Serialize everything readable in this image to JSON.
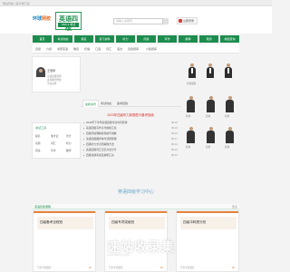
{
  "topbar": {
    "left_text": "网站导航 | 客户端下载",
    "right_text": ""
  },
  "header": {
    "logo_main": "环球",
    "logo_accent": "网校",
    "brand_title": "英语四级",
    "brand_subtitle": "CET-4 考试",
    "search_placeholder": "请输入关键词",
    "login_label": "立即登录"
  },
  "nav": [
    {
      "label": "首页"
    },
    {
      "label": "考试动态"
    },
    {
      "label": "报名"
    },
    {
      "label": "复习资料"
    },
    {
      "label": "听力"
    },
    {
      "label": "阅读"
    },
    {
      "label": "写作"
    },
    {
      "label": "翻译"
    },
    {
      "label": "真题"
    },
    {
      "label": "成绩查询"
    }
  ],
  "subnav": [
    "四级",
    "六级",
    "考研英语",
    "雅思",
    "托福",
    "口语",
    "词汇",
    "语法",
    "四级题库",
    "六级题库"
  ],
  "profile": {
    "name": "王老师",
    "lines": [
      "英语四级讲师",
      "多年教学经验",
      "学员好评"
    ]
  },
  "teacher_strip": {
    "label": "名师团队"
  },
  "news": {
    "tabs": [
      "最新资讯",
      "考试动态",
      "备考经验"
    ],
    "headline": "2023年四级听力新题型与备考指南",
    "items": [
      {
        "text": "2023年下半年英语四级考试时间安排",
        "date": "08-20"
      },
      {
        "text": "英语四级写作高分模板汇总",
        "date": "08-19"
      },
      {
        "text": "四级阅读理解答题技巧讲解",
        "date": "08-18"
      },
      {
        "text": "英语四级翻译常考话题整理",
        "date": "08-17"
      },
      {
        "text": "四级听力长对话解题方法",
        "date": "08-16"
      },
      {
        "text": "英语四级词汇记忆方法分享",
        "date": "08-15"
      },
      {
        "text": "四级真题答案及解析汇总",
        "date": "08-14"
      }
    ]
  },
  "grid_panel": {
    "title": "考试工具",
    "cells": [
      "报名",
      "准考证",
      "查分",
      "真题",
      "词汇",
      "听力",
      "阅读",
      "写作",
      "翻译"
    ]
  },
  "right_grid": {
    "labels": [
      "名师",
      "名师",
      "名师",
      "名师",
      "名师",
      "名师"
    ]
  },
  "center_link": "英语四级学习中心",
  "section": {
    "title": "英语四级课程",
    "more": "更多"
  },
  "cards": [
    {
      "title": "四级备考全程班",
      "foot": "已有学员报名",
      "price": "¥0"
    },
    {
      "title": "四级专项突破班",
      "foot": "已有学员报名",
      "price": "¥0"
    },
    {
      "title": "四级冲刺提分班",
      "foot": "已有学员报名",
      "price": "¥0"
    }
  ],
  "watermark": {
    "main": "速站收录集",
    "sub": "www.sumzz.com"
  },
  "colors": {
    "accent_green": "#1d8d4e",
    "headline_red": "#d9322b",
    "card_orange": "#e5843b"
  }
}
